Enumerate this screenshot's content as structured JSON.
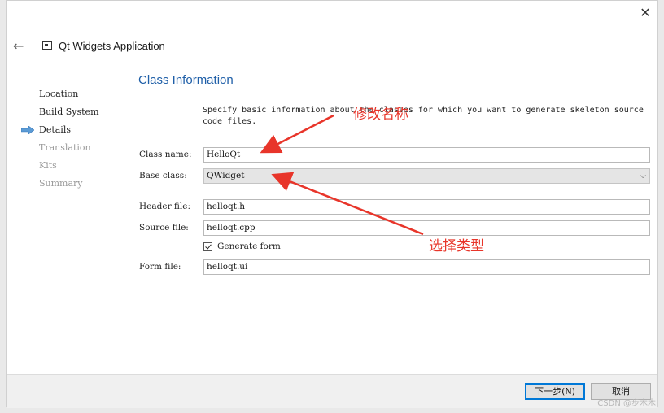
{
  "window": {
    "title": "Qt Widgets Application",
    "close_glyph": "✕",
    "back_glyph": "←"
  },
  "steps": [
    {
      "label": "Location",
      "state": "done"
    },
    {
      "label": "Build System",
      "state": "done"
    },
    {
      "label": "Details",
      "state": "current"
    },
    {
      "label": "Translation",
      "state": "pending"
    },
    {
      "label": "Kits",
      "state": "pending"
    },
    {
      "label": "Summary",
      "state": "pending"
    }
  ],
  "page": {
    "title": "Class Information",
    "description_line1": "Specify basic information about the classes for which you want to generate skeleton source",
    "description_line2": "code files."
  },
  "form": {
    "class_name_label": "Class name:",
    "class_name_value": "HelloQt",
    "base_class_label": "Base class:",
    "base_class_value": "QWidget",
    "header_file_label": "Header file:",
    "header_file_value": "helloqt.h",
    "source_file_label": "Source file:",
    "source_file_value": "helloqt.cpp",
    "generate_form_label": "Generate form",
    "generate_form_checked": true,
    "form_file_label": "Form file:",
    "form_file_value": "helloqt.ui"
  },
  "buttons": {
    "next_label": "下一步(N)",
    "cancel_label": "取消"
  },
  "annotations": {
    "rename_note": "修改名称",
    "choose_type_note": "选择类型",
    "color": "#e8352a"
  },
  "watermark": "CSDN @步木木",
  "colors": {
    "title_blue": "#1f5fa8",
    "step_arrow": "#5b9bd5",
    "primary_border": "#0078d7"
  }
}
